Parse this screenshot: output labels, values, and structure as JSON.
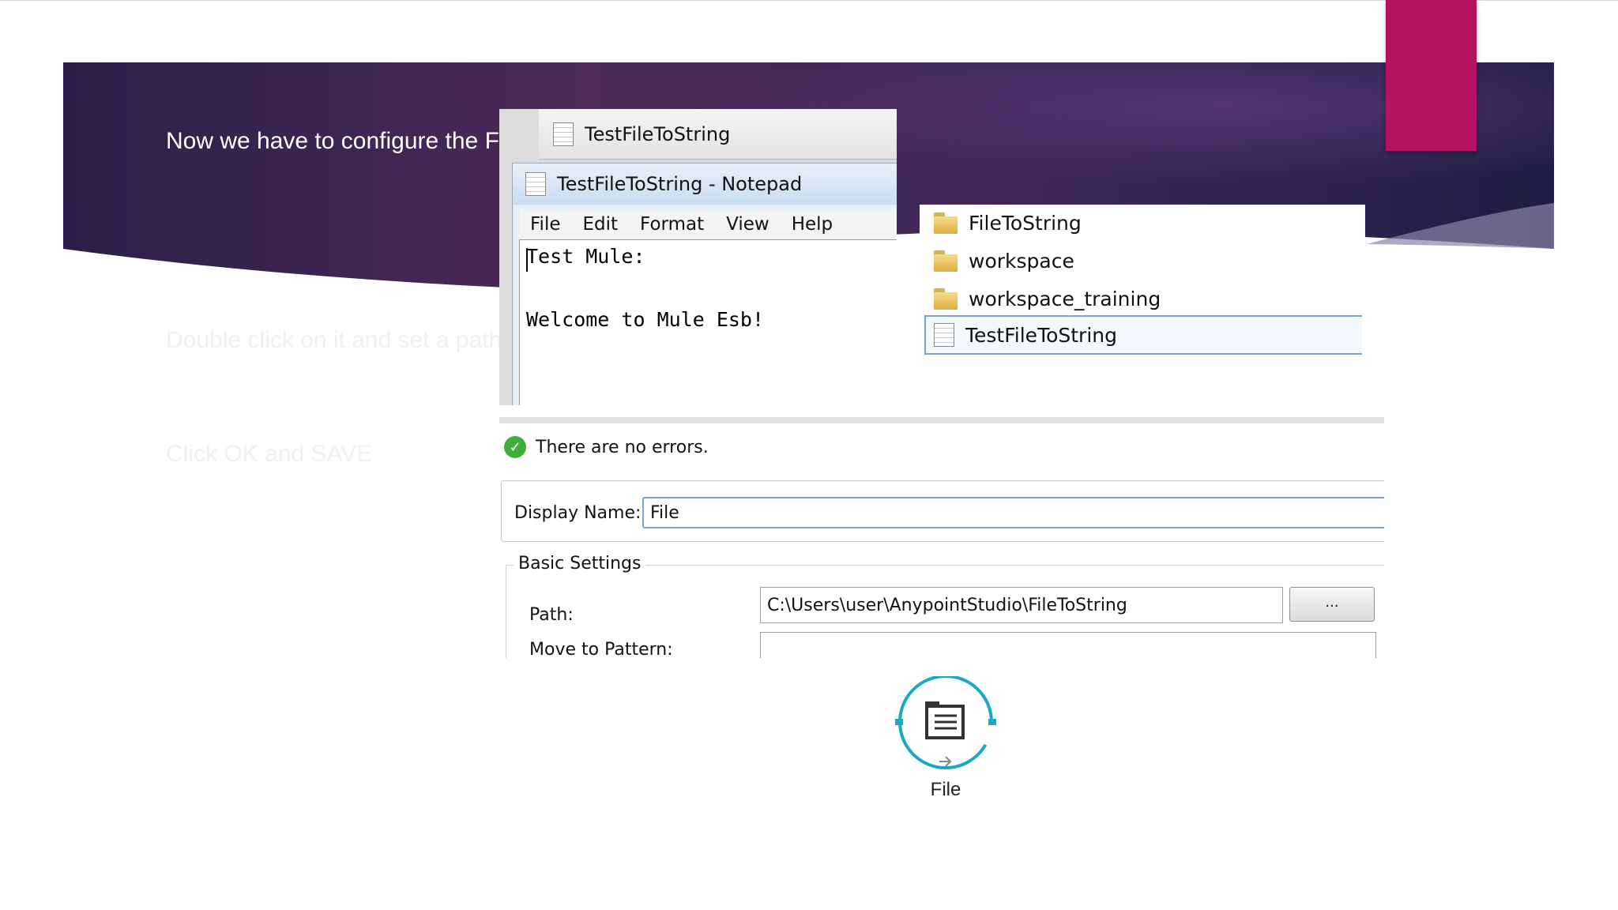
{
  "slide": {
    "heading": "Now we have to configure  the F",
    "bullet_2": "Double click on it and set a path",
    "bullet_3": "Click OK and SAVE",
    "colors": {
      "banner_dark": "#2a1f4a",
      "banner_mid": "#4f2a5a",
      "accent": "#b5135f"
    }
  },
  "notepad_tab": {
    "title": "TestFileToString",
    "icon": "text-document-icon"
  },
  "notepad": {
    "title": "TestFileToString - Notepad",
    "icon": "notepad-icon",
    "menu": [
      "File",
      "Edit",
      "Format",
      "View",
      "Help"
    ],
    "content_line_1": "Test Mule:",
    "content_line_2": "Welcome to Mule Esb!"
  },
  "explorer": {
    "items": [
      {
        "label": "FileToString",
        "icon": "folder-icon"
      },
      {
        "label": "workspace",
        "icon": "folder-icon"
      },
      {
        "label": "workspace_training",
        "icon": "folder-icon"
      },
      {
        "label": "TestFileToString",
        "icon": "text-document-icon",
        "selected": true
      }
    ]
  },
  "properties": {
    "status": "There are no errors.",
    "display_name_label": "Display Name:",
    "display_name_value": "File",
    "basic_settings_label": "Basic Settings",
    "path_label": "Path:",
    "path_value": "C:\\Users\\user\\AnypointStudio\\FileToString",
    "browse_label": "...",
    "move_to_pattern_label": "Move to Pattern:"
  },
  "connector": {
    "label": "File",
    "icon": "file-connector-icon",
    "color": "#19a9c6"
  }
}
